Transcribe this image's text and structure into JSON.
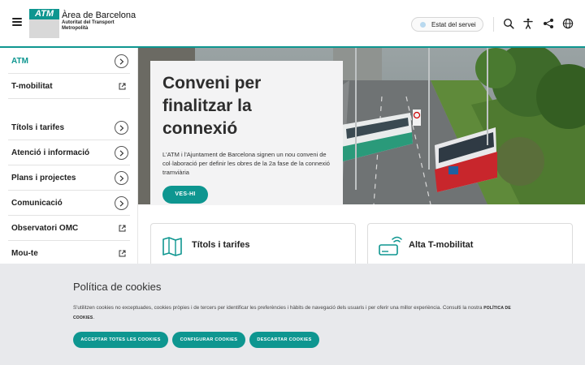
{
  "header": {
    "logo_mark": "ATM",
    "logo_title": "Àrea de Barcelona",
    "logo_sub1": "Autoritat del Transport",
    "logo_sub2": "Metropolità",
    "status_label": "Estat del servei",
    "icons": [
      "menu-icon",
      "search-icon",
      "accessibility-icon",
      "share-icon",
      "globe-icon"
    ]
  },
  "sidebar": {
    "items": [
      {
        "label": "ATM",
        "kind": "chevron",
        "active": true
      },
      {
        "label": "T-mobilitat",
        "kind": "external"
      },
      {
        "label": "Títols i tarifes",
        "kind": "chevron"
      },
      {
        "label": "Atenció i informació",
        "kind": "chevron"
      },
      {
        "label": "Plans i projectes",
        "kind": "chevron"
      },
      {
        "label": "Comunicació",
        "kind": "chevron"
      },
      {
        "label": "Observatori OMC",
        "kind": "external"
      },
      {
        "label": "Mou-te",
        "kind": "external"
      }
    ]
  },
  "hero": {
    "title_line1": "Conveni per",
    "title_line2": "finalitzar la",
    "title_line3": "connexió",
    "description": "L'ATM i l'Ajuntament de Barcelona signen un nou conveni de col·laboració per definir les obres de la 2a fase de la connexió tramviària",
    "button": "VES-HI"
  },
  "cards": [
    {
      "title": "Títols i tarifes",
      "icon": "ticket-map-icon"
    },
    {
      "title": "Alta T-mobilitat",
      "icon": "contactless-card-icon"
    }
  ],
  "cookies": {
    "title": "Política de cookies",
    "text": "S'utilitzen cookies no exceptuades, cookies pròpies i de tercers per identificar les preferències i hàbits de navegació dels usuaris i per oferir una millor experiència. Consulti la nostra",
    "link": "POLÍTICA DE COOKIES",
    "text_end": ".",
    "accept": "ACCEPTAR TOTES LES COOKIES",
    "configure": "CONFIGURAR COOKIES",
    "reject": "DESCARTAR COOKIES"
  },
  "colors": {
    "accent": "#0e9690",
    "banner_bg": "#e8e9ec",
    "card_bg": "#f3f3f4"
  }
}
